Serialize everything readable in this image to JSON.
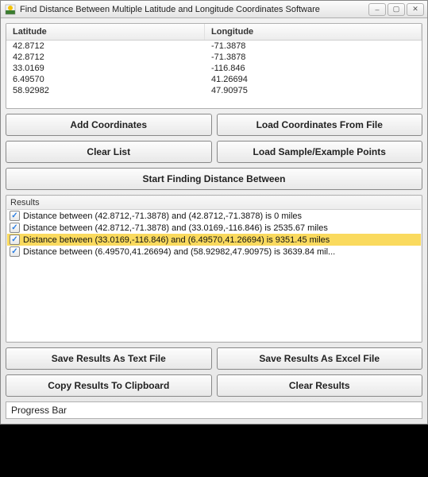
{
  "window": {
    "title": "Find Distance Between Multiple Latitude and Longitude Coordinates Software"
  },
  "coord_table": {
    "lat_header": "Latitude",
    "lon_header": "Longitude",
    "rows": [
      {
        "lat": "42.8712",
        "lon": "-71.3878"
      },
      {
        "lat": "42.8712",
        "lon": "-71.3878"
      },
      {
        "lat": "33.0169",
        "lon": "-116.846"
      },
      {
        "lat": "6.49570",
        "lon": "41.26694"
      },
      {
        "lat": "58.92982",
        "lon": "47.90975"
      }
    ]
  },
  "buttons": {
    "add_coordinates": "Add Coordinates",
    "load_from_file": "Load Coordinates From File",
    "clear_list": "Clear List",
    "load_sample": "Load Sample/Example Points",
    "start_finding": "Start Finding Distance Between",
    "save_text": "Save Results As Text File",
    "save_excel": "Save Results As Excel File",
    "copy_clipboard": "Copy Results To Clipboard",
    "clear_results": "Clear Results"
  },
  "results": {
    "label": "Results",
    "items": [
      {
        "text": "Distance between (42.8712,-71.3878) and (42.8712,-71.3878) is 0 miles",
        "selected": false
      },
      {
        "text": "Distance between (42.8712,-71.3878) and (33.0169,-116.846) is 2535.67 miles",
        "selected": false
      },
      {
        "text": "Distance between (33.0169,-116.846) and (6.49570,41.26694) is 9351.45 miles",
        "selected": true
      },
      {
        "text": "Distance between (6.49570,41.26694) and (58.92982,47.90975) is 3639.84 mil...",
        "selected": false
      }
    ]
  },
  "progress": {
    "label": "Progress Bar"
  }
}
